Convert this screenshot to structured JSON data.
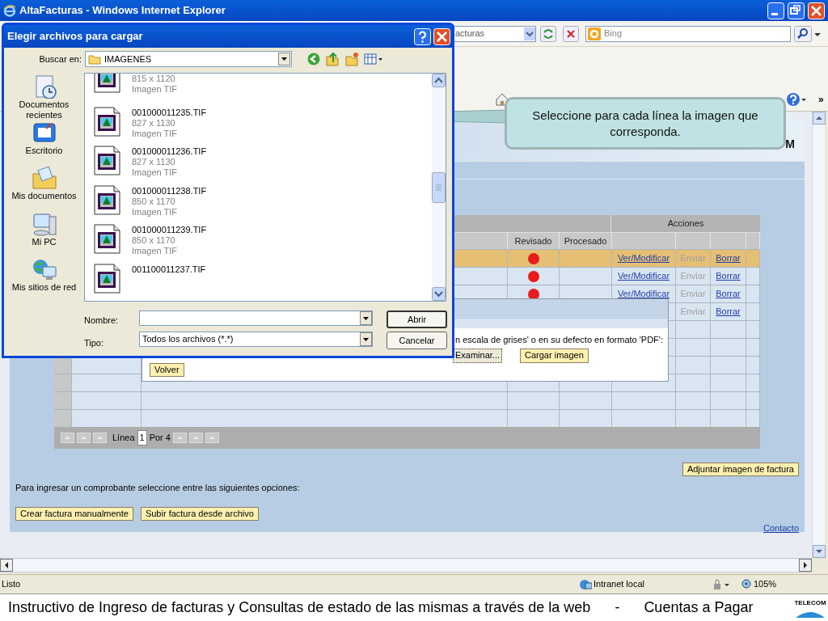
{
  "browser": {
    "title": "AltaFacturas - Windows Internet Explorer",
    "address_partial": "acturas",
    "search_placeholder": "Bing",
    "more": "»"
  },
  "page": {
    "header_logo_partial": "M",
    "table": {
      "group_header": "Acciones",
      "columns": [
        "Revisado",
        "Procesado"
      ],
      "rows": [
        {
          "selected": true,
          "color": "#e81c1c",
          "actions": [
            {
              "label": "Ver/Modificar",
              "disabled": false
            },
            {
              "label": "Enviar",
              "disabled": true
            },
            {
              "label": "Borrar",
              "disabled": false
            }
          ]
        },
        {
          "selected": false,
          "color": "#e81c1c",
          "actions": [
            {
              "label": "Ver/Modificar",
              "disabled": false
            },
            {
              "label": "Enviar",
              "disabled": true
            },
            {
              "label": "Borrar",
              "disabled": false
            }
          ]
        },
        {
          "selected": false,
          "color": "#e81c1c",
          "actions": [
            {
              "label": "Ver/Modificar",
              "disabled": false
            },
            {
              "label": "Enviar",
              "disabled": true
            },
            {
              "label": "Borrar",
              "disabled": false
            }
          ]
        },
        {
          "selected": false,
          "actions": [
            {
              "label": "Enviar",
              "disabled": true
            },
            {
              "label": "Borrar",
              "disabled": false
            }
          ]
        }
      ]
    },
    "pager": {
      "label": "Línea",
      "value": "1",
      "total": "Por 4"
    },
    "attach_button": "Adjuntar imagen de factura",
    "instructions": "Para ingresar un comprobante seleccione entre las siguientes opciones:",
    "buttons": [
      "Crear factura manualmente",
      "Subir factura desde archivo"
    ],
    "contact_link": "Contacto"
  },
  "upload_panel": {
    "text": "n escala de grises' o en su defecto en formato 'PDF':",
    "browse_button": "Examinar...",
    "upload_button": "Cargar imagen",
    "back_button": "Volver"
  },
  "file_dialog": {
    "title": "Elegir archivos para cargar",
    "look_in_label": "Buscar en:",
    "folder": "IMAGENES",
    "places": [
      "Documentos recientes",
      "Escritorio",
      "Mis documentos",
      "Mi PC",
      "Mis sitios de red"
    ],
    "files": [
      {
        "dimensions": "815 x 1120",
        "type": "Imagen TIF"
      },
      {
        "name": "001000011235.TIF",
        "dimensions": "827 x 1130",
        "type": "Imagen TIF"
      },
      {
        "name": "001000011236.TIF",
        "dimensions": "827 x 1130",
        "type": "Imagen TIF"
      },
      {
        "name": "001000011238.TIF",
        "dimensions": "850 x 1170",
        "type": "Imagen TIF"
      },
      {
        "name": "001000011239.TIF",
        "dimensions": "850 x 1170",
        "type": "Imagen TIF"
      },
      {
        "name": "001100011237.TIF"
      }
    ],
    "name_label": "Nombre:",
    "type_label": "Tipo:",
    "type_value": "Todos los archivos (*.*)",
    "open_button": "Abrir",
    "cancel_button": "Cancelar"
  },
  "callout": {
    "text": "Seleccione para cada línea la imagen que corresponda."
  },
  "status_bar": {
    "text": "Listo",
    "zone": "Intranet local",
    "zoom": "105%"
  },
  "footer": {
    "title": "Instructivo de Ingreso de facturas y Consultas de estado de las mismas a través de la web",
    "separator": "-",
    "section": "Cuentas a Pagar",
    "logo": "TELECOM"
  }
}
